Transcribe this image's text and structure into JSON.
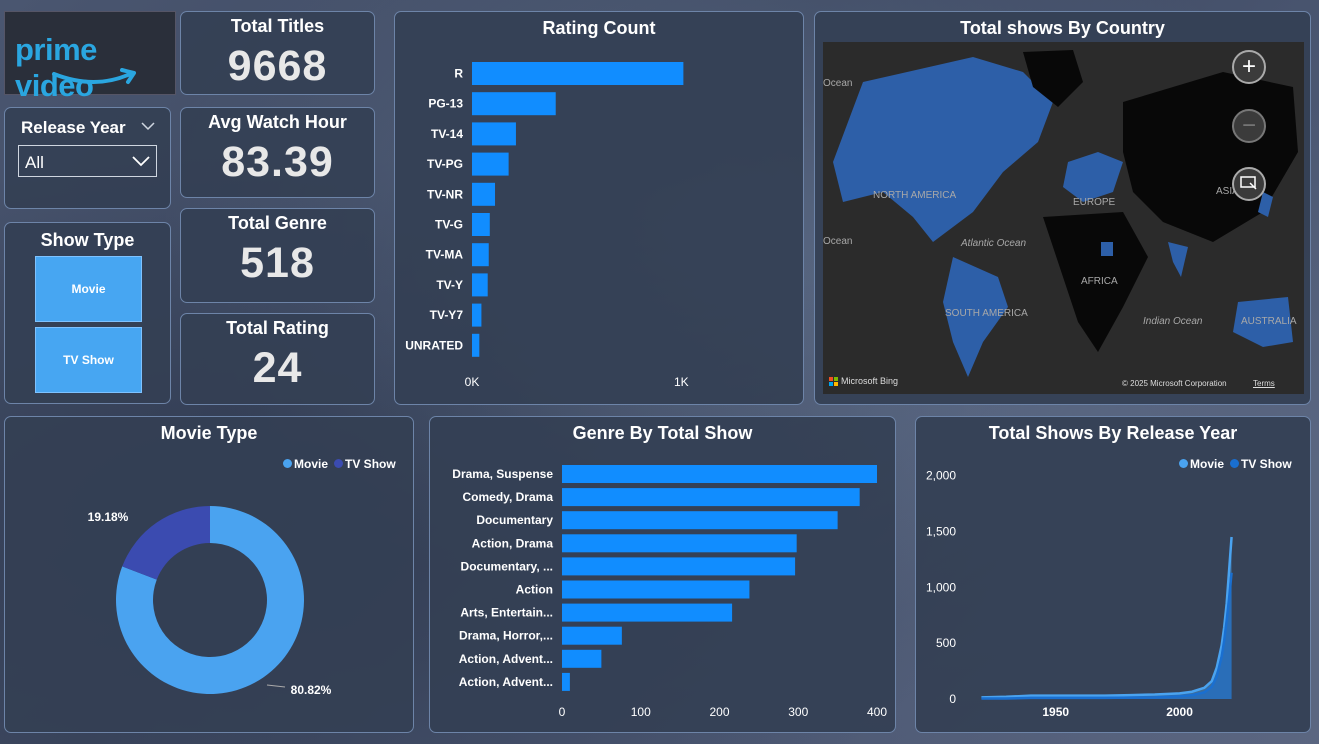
{
  "brand": {
    "logo_text": "prime video",
    "logo_color": "#2aa6e0"
  },
  "filters": {
    "release_year_label": "Release Year",
    "release_year_value": "All",
    "show_type_label": "Show Type",
    "show_type_options": [
      "Movie",
      "TV Show"
    ]
  },
  "kpis": [
    {
      "label": "Total Titles",
      "value": "9668"
    },
    {
      "label": "Avg Watch Hour",
      "value": "83.39"
    },
    {
      "label": "Total Genre",
      "value": "518"
    },
    {
      "label": "Total Rating",
      "value": "24"
    }
  ],
  "map": {
    "title": "Total shows By Country",
    "labels": [
      "Ocean",
      "NORTH AMERICA",
      "EUROPE",
      "ASIA",
      "Atlantic Ocean",
      "AFRICA",
      "SOUTH AMERICA",
      "Indian Ocean",
      "AUSTRALIA",
      "Ocean"
    ],
    "credit_left": "Microsoft Bing",
    "credit_right": "© 2025 Microsoft Corporation",
    "terms": "Terms",
    "zoom_in_icon": "plus-icon",
    "zoom_out_icon": "minus-icon",
    "select_icon": "select-cursor-icon"
  },
  "chart_data": [
    {
      "title": "Rating Count",
      "type": "bar",
      "orientation": "horizontal",
      "categories": [
        "R",
        "PG-13",
        "TV-14",
        "TV-PG",
        "TV-NR",
        "TV-G",
        "TV-MA",
        "TV-Y",
        "TV-Y7",
        "UNRATED"
      ],
      "values": [
        1010,
        400,
        210,
        175,
        110,
        85,
        80,
        75,
        45,
        35
      ],
      "xlim": [
        0,
        1400
      ],
      "x_ticks": [
        "0K",
        "1K"
      ],
      "color": "#118dff"
    },
    {
      "title": "Movie Type",
      "type": "pie",
      "donut": true,
      "legend": [
        "Movie",
        "TV Show"
      ],
      "legend_colors": [
        "#4aa3f0",
        "#3b4bb0"
      ],
      "values": [
        80.82,
        19.18
      ],
      "value_labels": [
        "80.82%",
        "19.18%"
      ],
      "legend_position": "top-right"
    },
    {
      "title": "Genre By Total Show",
      "type": "bar",
      "orientation": "horizontal",
      "categories": [
        "Drama, Suspense",
        "Comedy, Drama",
        "Documentary",
        "Action, Drama",
        "Documentary, ...",
        "Action",
        "Arts, Entertain...",
        "Drama, Horror,...",
        "Action, Advent...",
        "Action, Advent..."
      ],
      "values": [
        400,
        378,
        350,
        298,
        296,
        238,
        216,
        76,
        50,
        10
      ],
      "xlim": [
        0,
        420
      ],
      "x_ticks": [
        "0",
        "100",
        "200",
        "300",
        "400"
      ],
      "color": "#118dff"
    },
    {
      "title": "Total Shows By Release Year",
      "type": "area",
      "legend": [
        "Movie",
        "TV Show"
      ],
      "legend_colors": [
        "#4aa3f0",
        "#1a6fd0"
      ],
      "legend_position": "top-right",
      "x": [
        1920,
        1930,
        1940,
        1950,
        1960,
        1970,
        1980,
        1990,
        2000,
        2005,
        2010,
        2013,
        2015,
        2017,
        2018,
        2019,
        2020,
        2021
      ],
      "series": [
        {
          "name": "Movie",
          "values": [
            15,
            20,
            30,
            30,
            30,
            30,
            35,
            40,
            50,
            65,
            100,
            160,
            280,
            480,
            640,
            850,
            1150,
            1450
          ]
        },
        {
          "name": "TV Show",
          "values": [
            5,
            5,
            10,
            10,
            10,
            10,
            12,
            15,
            25,
            35,
            60,
            110,
            200,
            380,
            520,
            700,
            900,
            1130
          ]
        }
      ],
      "xlim": [
        1917,
        2024
      ],
      "ylim": [
        0,
        2300
      ],
      "y_ticks": [
        "0",
        "500",
        "1,000",
        "1,500",
        "2,000"
      ],
      "x_ticks": [
        "1950",
        "2000"
      ]
    }
  ]
}
